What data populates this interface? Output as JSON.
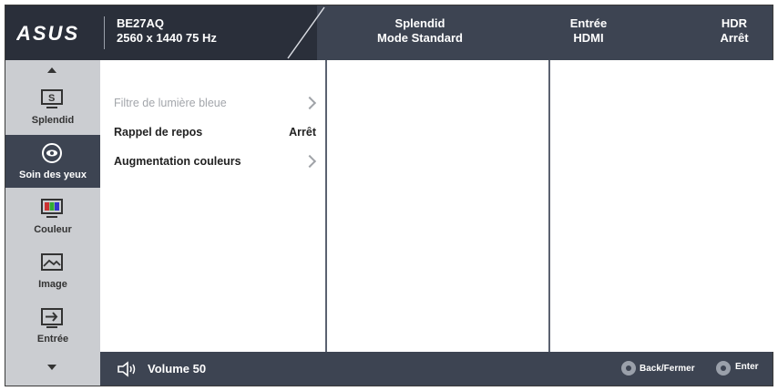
{
  "header": {
    "logo_text": "ASUS",
    "model": "BE27AQ",
    "resolution": "2560 x 1440 75 Hz",
    "columns": [
      {
        "title": "Splendid",
        "value": "Mode Standard"
      },
      {
        "title": "Entrée",
        "value": "HDMI"
      },
      {
        "title": "HDR",
        "value": "Arrêt"
      }
    ]
  },
  "sidebar": {
    "items": [
      {
        "label": "Splendid",
        "icon": "splendid-icon"
      },
      {
        "label": "Soin des yeux",
        "icon": "eye-care-icon"
      },
      {
        "label": "Couleur",
        "icon": "color-icon"
      },
      {
        "label": "Image",
        "icon": "image-icon"
      },
      {
        "label": "Entrée",
        "icon": "input-icon"
      }
    ]
  },
  "menu": {
    "items": [
      {
        "label": "Filtre de lumière bleue",
        "value": ""
      },
      {
        "label": "Rappel de repos",
        "value": "Arrêt"
      },
      {
        "label": "Augmentation couleurs",
        "value": ""
      }
    ]
  },
  "footer": {
    "volume_label": "Volume 50",
    "back_label": "Back/Fermer",
    "enter_label": "Enter"
  },
  "colors": {
    "header_bg": "#3d4452",
    "header_left_bg": "#2a2f3a",
    "sidebar_bg": "#cbcdd1",
    "active_bg": "#3d4452"
  }
}
